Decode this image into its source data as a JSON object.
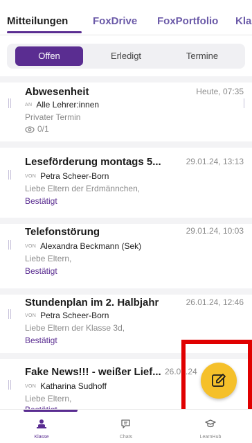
{
  "top_tabs": [
    {
      "label": "Mitteilungen"
    },
    {
      "label": "FoxDrive"
    },
    {
      "label": "FoxPortfolio"
    },
    {
      "label": "Kla"
    }
  ],
  "segment": {
    "offen": "Offen",
    "erledigt": "Erledigt",
    "termine": "Termine"
  },
  "messages": [
    {
      "title": "Abwesenheit",
      "date": "Heute, 07:35",
      "tag": "AN",
      "person": "Alle Lehrer:innen",
      "sub": "Privater Termin",
      "reads": "0/1",
      "status": ""
    },
    {
      "title": "Leseförderung montags 5...",
      "date": "29.01.24, 13:13",
      "tag": "VON",
      "person": "Petra Scheer-Born",
      "sub": "Liebe Eltern der Erdmännchen,",
      "status": "Bestätigt"
    },
    {
      "title": "Telefonstörung",
      "date": "29.01.24, 10:03",
      "tag": "VON",
      "person": "Alexandra Beckmann (Sek)",
      "sub": "Liebe Eltern,",
      "status": "Bestätigt"
    },
    {
      "title": "Stundenplan im 2. Halbjahr",
      "date": "26.01.24, 12:46",
      "tag": "VON",
      "person": "Petra Scheer-Born",
      "sub": "Liebe Eltern der Klasse 3d,",
      "status": "Bestätigt"
    },
    {
      "title": "Fake News!!! - weißer Lief...",
      "date": "26.01.24",
      "tag": "VON",
      "person": "Katharina Sudhoff",
      "sub": "Liebe Eltern,",
      "status": "Bestätigt"
    }
  ],
  "fab": {
    "icon": "edit-icon"
  },
  "bottom_nav": [
    {
      "label": "Klasse",
      "icon": "class-icon"
    },
    {
      "label": "Chats",
      "icon": "chat-icon"
    },
    {
      "label": "LearnHub",
      "icon": "graduation-cap-icon"
    }
  ],
  "colors": {
    "accent": "#5a2d91",
    "fab": "#f5c02a",
    "highlight": "#e00000"
  }
}
